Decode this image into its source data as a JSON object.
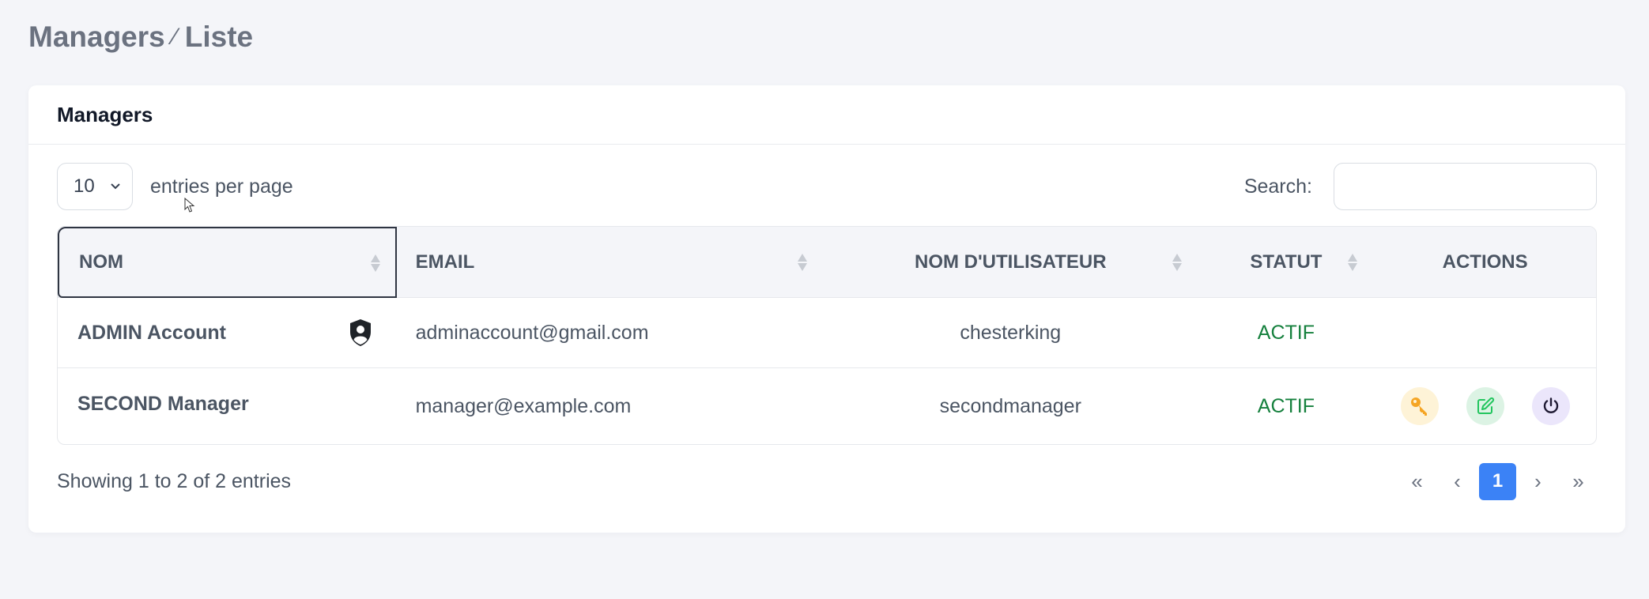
{
  "breadcrumb": {
    "section": "Managers",
    "separator": "⁄",
    "page": "Liste"
  },
  "card": {
    "title": "Managers"
  },
  "controls": {
    "per_page_value": "10",
    "per_page_label": "entries per page",
    "search_label": "Search:",
    "search_value": ""
  },
  "table": {
    "headers": {
      "nom": "NOM",
      "email": "EMAIL",
      "username": "NOM D'UTILISATEUR",
      "statut": "STATUT",
      "actions": "ACTIONS"
    },
    "rows": [
      {
        "nom": "ADMIN Account",
        "email": "adminaccount@gmail.com",
        "username": "chesterking",
        "statut": "ACTIF",
        "admin_badge": "shield-user-icon",
        "actions": []
      },
      {
        "nom": "SECOND Manager",
        "email": "manager@example.com",
        "username": "secondmanager",
        "statut": "ACTIF",
        "actions": [
          "key-icon",
          "edit-icon",
          "power-icon"
        ]
      }
    ]
  },
  "footer": {
    "info": "Showing 1 to 2 of 2 entries",
    "pagination": {
      "first": "«",
      "prev": "‹",
      "current": "1",
      "next": "›",
      "last": "»"
    }
  },
  "colors": {
    "status_active": "#15803d",
    "primary": "#3b82f6",
    "key_bg": "#fef3d7",
    "key_fg": "#f5a524",
    "edit_bg": "#dcf3e4",
    "edit_fg": "#22c55e",
    "power_bg": "#ebe6fb",
    "power_fg": "#1f1a33"
  }
}
